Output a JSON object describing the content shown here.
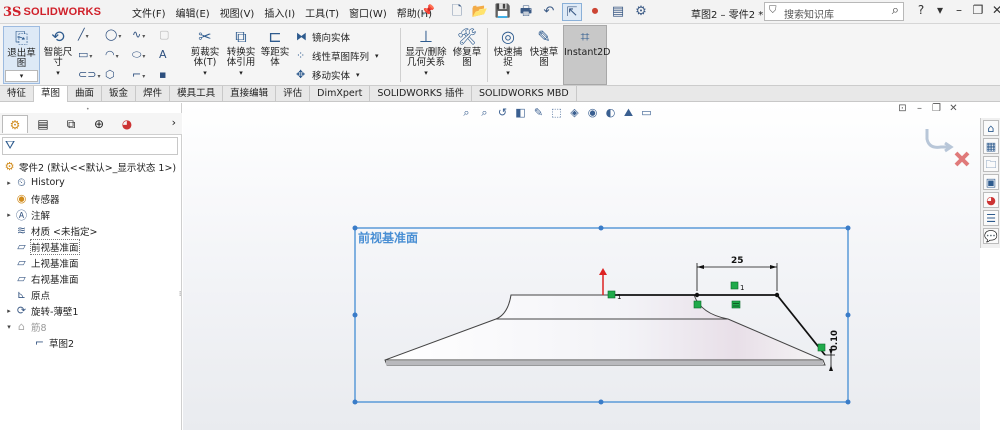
{
  "app": {
    "logo_mark": "3S",
    "logo_text": "SOLIDWORKS"
  },
  "menu": [
    "文件(F)",
    "编辑(E)",
    "视图(V)",
    "插入(I)",
    "工具(T)",
    "窗口(W)",
    "帮助(H)"
  ],
  "quick_access": {
    "icons": [
      "new-icon",
      "open-icon",
      "save-icon",
      "print-icon",
      "undo-icon",
      "select-icon",
      "rebuild-icon",
      "file-properties-icon",
      "options-icon"
    ],
    "glyphs": [
      "🗋",
      "📂",
      "💾",
      "🖶",
      "↶",
      "⇱",
      "⏺",
      "▤",
      "⚙"
    ]
  },
  "document_title": "草图2 – 零件2 *",
  "search": {
    "placeholder": "搜索知识库"
  },
  "window_controls": [
    "?",
    "▾",
    "–",
    "❐",
    "✕"
  ],
  "command_manager": {
    "exit_sketch": "退出草\n图",
    "smart_dimension": "智能尺\n寸",
    "trim": "剪裁实\n体(T)",
    "convert": "转换实\n体引用",
    "offset": "等距实\n体",
    "mirror": "镜向实体",
    "linear_pattern": "线性草图阵列",
    "move": "移动实体",
    "show_relations": "显示/删除\n几何关系",
    "repair": "修复草\n图",
    "quick_snaps": "快速捕\n捉",
    "rapid_sketch": "快速草\n图",
    "instant2d": "Instant2D"
  },
  "tabs": [
    "特征",
    "草图",
    "曲面",
    "钣金",
    "焊件",
    "模具工具",
    "直接编辑",
    "评估",
    "DimXpert",
    "SOLIDWORKS 插件",
    "SOLIDWORKS MBD"
  ],
  "active_tab": "草图",
  "feature_tree": {
    "root": "零件2 (默认<<默认>_显示状态 1>)",
    "items": [
      {
        "label": "History",
        "icon": "history-icon",
        "arrow": "▸"
      },
      {
        "label": "传感器",
        "icon": "sensor-icon",
        "arrow": ""
      },
      {
        "label": "注解",
        "icon": "annotation-icon",
        "arrow": "▸"
      },
      {
        "label": "材质 <未指定>",
        "icon": "material-icon",
        "arrow": ""
      },
      {
        "label": "前视基准面",
        "icon": "plane-icon",
        "arrow": ""
      },
      {
        "label": "上视基准面",
        "icon": "plane-icon",
        "arrow": ""
      },
      {
        "label": "右视基准面",
        "icon": "plane-icon",
        "arrow": ""
      },
      {
        "label": "原点",
        "icon": "origin-icon",
        "arrow": ""
      },
      {
        "label": "旋转-薄壁1",
        "icon": "revolve-icon",
        "arrow": "▸"
      },
      {
        "label": "筋8",
        "icon": "rib-icon",
        "arrow": "▾"
      },
      {
        "label": "草图2",
        "icon": "sketch-icon",
        "arrow": ""
      }
    ]
  },
  "viewport": {
    "plane_label": "前视基准面",
    "dimension_horizontal": "25",
    "dimension_vertical": "0.10",
    "relation_marks": [
      "1",
      "1"
    ]
  }
}
